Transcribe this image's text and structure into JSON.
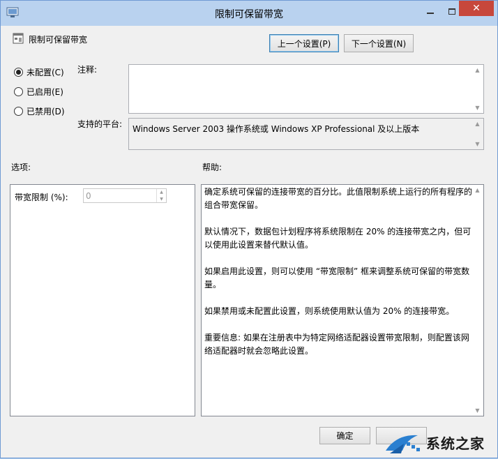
{
  "window": {
    "title": "限制可保留带宽",
    "close_glyph": "✕"
  },
  "header": {
    "policy_name": "限制可保留带宽",
    "prev_button": "上一个设置(P)",
    "next_button": "下一个设置(N)"
  },
  "state": {
    "options": [
      {
        "label": "未配置(C)",
        "selected": true
      },
      {
        "label": "已启用(E)",
        "selected": false
      },
      {
        "label": "已禁用(D)",
        "selected": false
      }
    ]
  },
  "comment": {
    "label": "注释:",
    "value": ""
  },
  "platform": {
    "label": "支持的平台:",
    "value": "Windows Server 2003 操作系统或 Windows XP Professional 及以上版本"
  },
  "options_panel": {
    "label": "选项:",
    "bandwidth_label": "带宽限制 (%):",
    "bandwidth_value": "0"
  },
  "help_panel": {
    "label": "帮助:",
    "paragraphs": [
      "确定系统可保留的连接带宽的百分比。此值限制系统上运行的所有程序的组合带宽保留。",
      "默认情况下，数据包计划程序将系统限制在 20% 的连接带宽之内，但可以使用此设置来替代默认值。",
      "如果启用此设置，则可以使用 “带宽限制” 框来调整系统可保留的带宽数量。",
      "如果禁用或未配置此设置，则系统使用默认值为 20% 的连接带宽。",
      "重要信息: 如果在注册表中为特定网络适配器设置带宽限制，则配置该网络适配器时就会忽略此设置。"
    ]
  },
  "footer": {
    "ok_button": "确定",
    "cancel_button": ""
  },
  "watermark": {
    "text": "系统之家"
  },
  "colors": {
    "titlebar": "#b9d2ef",
    "close": "#c7473b",
    "accent_border": "#3c7fb1"
  }
}
